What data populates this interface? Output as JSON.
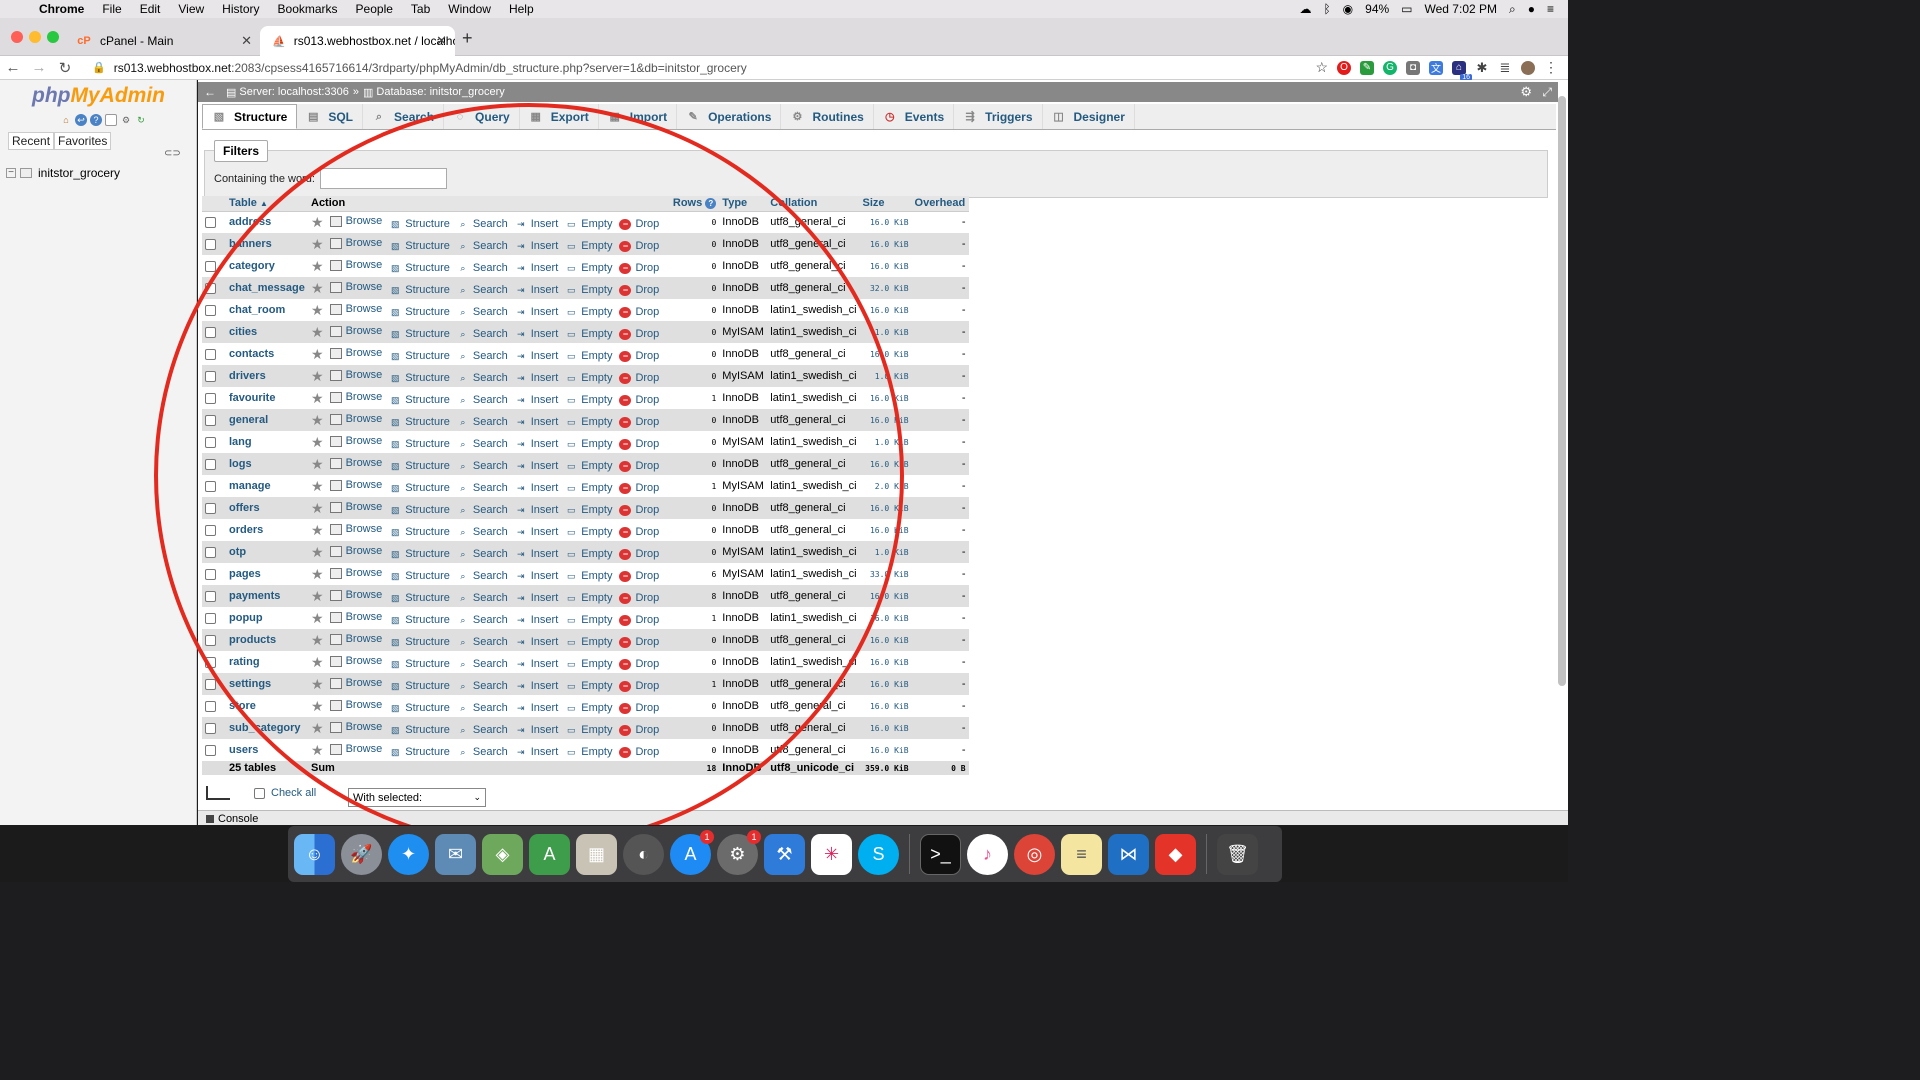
{
  "menubar": {
    "app": "Chrome",
    "items": [
      "File",
      "Edit",
      "View",
      "History",
      "Bookmarks",
      "People",
      "Tab",
      "Window",
      "Help"
    ],
    "battery": "94%",
    "clock": "Wed 7:02 PM"
  },
  "tabs": [
    {
      "title": "cPanel - Main",
      "favicon": "cP"
    },
    {
      "title": "rs013.webhostbox.net / localho",
      "favicon": "pma"
    }
  ],
  "address": {
    "host": "rs013.webhostbox.net",
    "path": ":2083/cpsess4165716614/3rdparty/phpMyAdmin/db_structure.php?server=1&db=initstor_grocery"
  },
  "extensions": {
    "badge": "16"
  },
  "sidebar": {
    "logo_php": "php",
    "logo_mya": "MyAdmin",
    "recent": "Recent",
    "favorites": "Favorites",
    "db": "initstor_grocery"
  },
  "breadcrumb": {
    "server": "Server: localhost:3306",
    "sep": "»",
    "database": "Database: initstor_grocery"
  },
  "pma_tabs": [
    "Structure",
    "SQL",
    "Search",
    "Query",
    "Export",
    "Import",
    "Operations",
    "Routines",
    "Events",
    "Triggers",
    "Designer"
  ],
  "filters": {
    "legend": "Filters",
    "label": "Containing the word:",
    "value": ""
  },
  "table_headers": {
    "table": "Table",
    "action": "Action",
    "rows": "Rows",
    "type": "Type",
    "collation": "Collation",
    "size": "Size",
    "overhead": "Overhead"
  },
  "actions": [
    "Browse",
    "Structure",
    "Search",
    "Insert",
    "Empty",
    "Drop"
  ],
  "rows": [
    {
      "name": "address",
      "rows": "0",
      "type": "InnoDB",
      "collation": "utf8_general_ci",
      "size": "16.0 KiB",
      "overhead": "-"
    },
    {
      "name": "banners",
      "rows": "0",
      "type": "InnoDB",
      "collation": "utf8_general_ci",
      "size": "16.0 KiB",
      "overhead": "-"
    },
    {
      "name": "category",
      "rows": "0",
      "type": "InnoDB",
      "collation": "utf8_general_ci",
      "size": "16.0 KiB",
      "overhead": "-"
    },
    {
      "name": "chat_message",
      "rows": "0",
      "type": "InnoDB",
      "collation": "utf8_general_ci",
      "size": "32.0 KiB",
      "overhead": "-"
    },
    {
      "name": "chat_room",
      "rows": "0",
      "type": "InnoDB",
      "collation": "latin1_swedish_ci",
      "size": "16.0 KiB",
      "overhead": "-"
    },
    {
      "name": "cities",
      "rows": "0",
      "type": "MyISAM",
      "collation": "latin1_swedish_ci",
      "size": "1.0 KiB",
      "overhead": "-"
    },
    {
      "name": "contacts",
      "rows": "0",
      "type": "InnoDB",
      "collation": "utf8_general_ci",
      "size": "16.0 KiB",
      "overhead": "-"
    },
    {
      "name": "drivers",
      "rows": "0",
      "type": "MyISAM",
      "collation": "latin1_swedish_ci",
      "size": "1.0 KiB",
      "overhead": "-"
    },
    {
      "name": "favourite",
      "rows": "1",
      "type": "InnoDB",
      "collation": "latin1_swedish_ci",
      "size": "16.0 KiB",
      "overhead": "-"
    },
    {
      "name": "general",
      "rows": "0",
      "type": "InnoDB",
      "collation": "utf8_general_ci",
      "size": "16.0 KiB",
      "overhead": "-"
    },
    {
      "name": "lang",
      "rows": "0",
      "type": "MyISAM",
      "collation": "latin1_swedish_ci",
      "size": "1.0 KiB",
      "overhead": "-"
    },
    {
      "name": "logs",
      "rows": "0",
      "type": "InnoDB",
      "collation": "utf8_general_ci",
      "size": "16.0 KiB",
      "overhead": "-"
    },
    {
      "name": "manage",
      "rows": "1",
      "type": "MyISAM",
      "collation": "latin1_swedish_ci",
      "size": "2.0 KiB",
      "overhead": "-"
    },
    {
      "name": "offers",
      "rows": "0",
      "type": "InnoDB",
      "collation": "utf8_general_ci",
      "size": "16.0 KiB",
      "overhead": "-"
    },
    {
      "name": "orders",
      "rows": "0",
      "type": "InnoDB",
      "collation": "utf8_general_ci",
      "size": "16.0 KiB",
      "overhead": "-"
    },
    {
      "name": "otp",
      "rows": "0",
      "type": "MyISAM",
      "collation": "latin1_swedish_ci",
      "size": "1.0 KiB",
      "overhead": "-"
    },
    {
      "name": "pages",
      "rows": "6",
      "type": "MyISAM",
      "collation": "latin1_swedish_ci",
      "size": "33.0 KiB",
      "overhead": "-"
    },
    {
      "name": "payments",
      "rows": "8",
      "type": "InnoDB",
      "collation": "utf8_general_ci",
      "size": "16.0 KiB",
      "overhead": "-"
    },
    {
      "name": "popup",
      "rows": "1",
      "type": "InnoDB",
      "collation": "latin1_swedish_ci",
      "size": "16.0 KiB",
      "overhead": "-"
    },
    {
      "name": "products",
      "rows": "0",
      "type": "InnoDB",
      "collation": "utf8_general_ci",
      "size": "16.0 KiB",
      "overhead": "-"
    },
    {
      "name": "rating",
      "rows": "0",
      "type": "InnoDB",
      "collation": "latin1_swedish_ci",
      "size": "16.0 KiB",
      "overhead": "-"
    },
    {
      "name": "settings",
      "rows": "1",
      "type": "InnoDB",
      "collation": "utf8_general_ci",
      "size": "16.0 KiB",
      "overhead": "-"
    },
    {
      "name": "store",
      "rows": "0",
      "type": "InnoDB",
      "collation": "utf8_general_ci",
      "size": "16.0 KiB",
      "overhead": "-"
    },
    {
      "name": "sub_category",
      "rows": "0",
      "type": "InnoDB",
      "collation": "utf8_general_ci",
      "size": "16.0 KiB",
      "overhead": "-"
    },
    {
      "name": "users",
      "rows": "0",
      "type": "InnoDB",
      "collation": "utf8_general_ci",
      "size": "16.0 KiB",
      "overhead": "-"
    }
  ],
  "summary": {
    "count": "25 tables",
    "label": "Sum",
    "rows": "18",
    "type": "InnoDB",
    "collation": "utf8_unicode_ci",
    "size": "359.0 KiB",
    "overhead": "0 B"
  },
  "bottom": {
    "check_all": "Check all",
    "with_selected": "With selected:"
  },
  "console": "Console",
  "dock": {
    "badge_appstore": "1",
    "badge_prefs": "1"
  },
  "colors": {
    "link": "#235a81",
    "annotation": "#e32a1f"
  }
}
